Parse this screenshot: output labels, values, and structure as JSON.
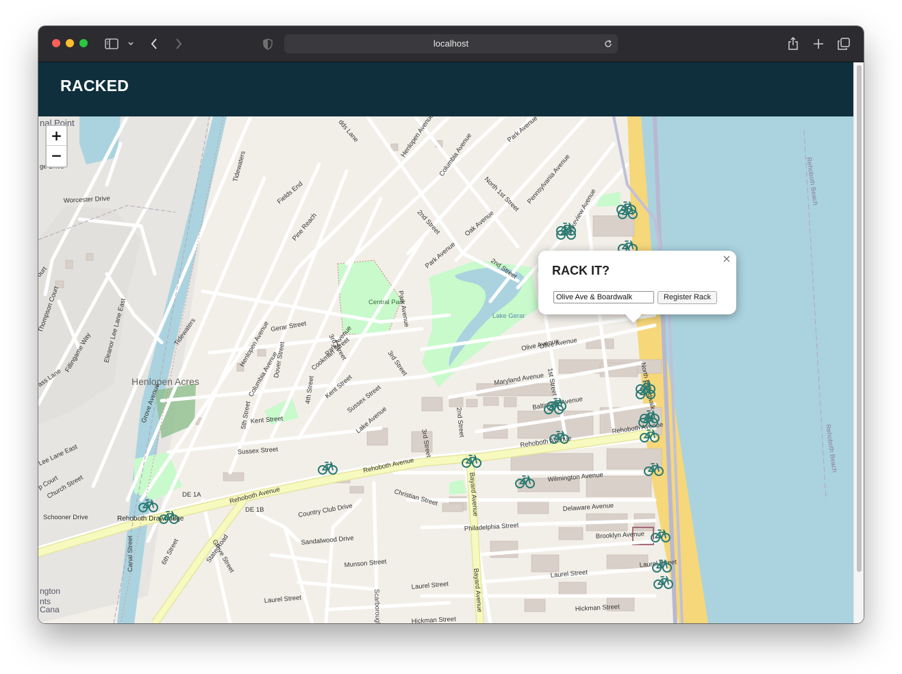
{
  "browser": {
    "url": "localhost",
    "icons": [
      "sidebar-icon",
      "chevron-down-icon",
      "back-icon",
      "forward-icon",
      "shield-icon",
      "reload-icon",
      "share-icon",
      "new-tab-icon",
      "tabs-overview-icon"
    ]
  },
  "header": {
    "brand": "RACKED"
  },
  "map": {
    "zoom_in_label": "+",
    "zoom_out_label": "−",
    "colors": {
      "water": "#aad3df",
      "beach": "#f6d77a",
      "park": "#c8facc",
      "primary_road": "#f7fabf",
      "land": "#f2efe9",
      "marker": "#2b7a72"
    },
    "place_labels": [
      "Henlopen Acres",
      "Central Park",
      "Lake Gerar",
      "Rehoboth Drawbridge",
      "Rehoboth Beach",
      "Rehoboth Beach",
      "nal Point",
      "ngton",
      "nts",
      "Cana"
    ],
    "road_labels": [
      "Rehoboth Avenue",
      "Rehoboth Avenue",
      "Rehoboth Avenue",
      "Rehoboth Avenue",
      "DE 1A",
      "DE 1B",
      "State Road",
      "Grove Street",
      "Canal Street",
      "6th Street",
      "Country Club Drive",
      "Sandalwood Drive",
      "Munson Street",
      "Laurel Street",
      "Laurel Street",
      "Laurel Street",
      "Laurel Street",
      "Scarborough",
      "Bayard Avenue",
      "Bayard Avenue",
      "Philadelphia Street",
      "Delaware Avenue",
      "Brooklyn Avenue",
      "Hickman Street",
      "Hickman Street",
      "Wilmington Avenue",
      "Christian Street",
      "Baltimore Avenue",
      "Maryland Avenue",
      "Olive Avenue",
      "North Boardwalk",
      "1st Street",
      "2nd Street",
      "2nd Street",
      "2nd Street",
      "3rd Street",
      "3rd Street",
      "3rd Street",
      "4th Street",
      "5th Street",
      "Sussex Street",
      "Sussex Street",
      "Kent Street",
      "Kent Street",
      "Dover Street",
      "Cookman Street",
      "Lake Avenue",
      "Gerar Street",
      "Park Avenue",
      "Park Avenue",
      "Park Avenue",
      "Park Avenue",
      "Oak Avenue",
      "Pennsylvania Avenue",
      "Lakeview Avenue",
      "Olive Avenue",
      "North 1st Street",
      "Henlopen Avenue",
      "Henlopen Avenue",
      "Columbia Avenue",
      "Columbia Avenue",
      "Grove Avenue",
      "Tidewaters",
      "Tidewaters",
      "Fields End",
      "Pine Reach",
      "Worcester Drive",
      "Thompson Court",
      "Eleanor Lee Lane East",
      "Fillingame Way",
      "Lee Lane East",
      "Church Street",
      "Schooner Drive",
      "ass Lane",
      "dds Lane",
      "ge Drive",
      "ourt",
      "p Court"
    ],
    "rack_marker_count": 22,
    "marker_icon": "bicycle-icon"
  },
  "popup": {
    "title": "RACK IT?",
    "input_value": "Olive Ave & Boardwalk",
    "button_label": "Register Rack",
    "close_label": "×"
  }
}
